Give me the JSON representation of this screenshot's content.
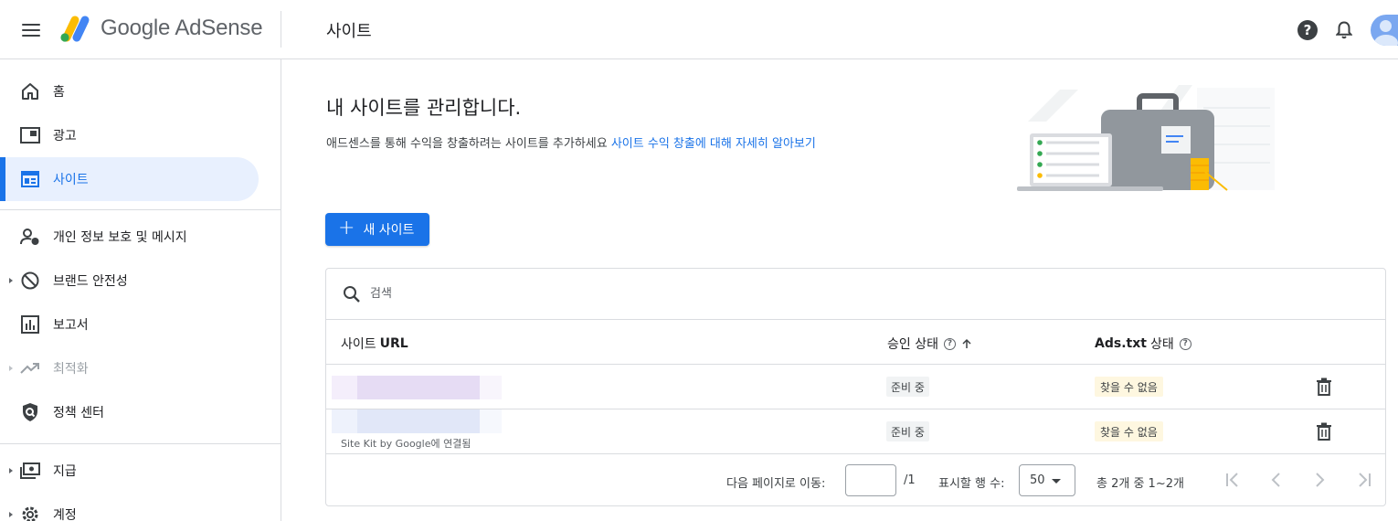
{
  "header": {
    "product_name": "Google AdSense",
    "page_title": "사이트"
  },
  "sidebar": {
    "items": [
      {
        "label": "홈",
        "icon": "home-icon"
      },
      {
        "label": "광고",
        "icon": "ads-icon"
      },
      {
        "label": "사이트",
        "icon": "sites-icon",
        "active": true
      },
      {
        "label": "개인 정보 보호 및 메시지",
        "icon": "privacy-messaging-icon"
      },
      {
        "label": "브랜드 안전성",
        "icon": "block-icon"
      },
      {
        "label": "보고서",
        "icon": "reports-icon"
      },
      {
        "label": "최적화",
        "icon": "trending-up-icon",
        "disabled": true
      },
      {
        "label": "정책 센터",
        "icon": "policy-shield-icon"
      },
      {
        "label": "지급",
        "icon": "payments-icon"
      },
      {
        "label": "계정",
        "icon": "settings-icon"
      }
    ]
  },
  "main": {
    "title": "내 사이트를 관리합니다.",
    "subtitle": "애드센스를 통해 수익을 창출하려는 사이트를 추가하세요",
    "learn_more_link": "사이트 수익 창출에 대해 자세히 알아보기",
    "new_site_button": "새 사이트"
  },
  "table": {
    "search_placeholder": "검색",
    "columns": {
      "site_url_prefix": "사이트",
      "site_url_suffix": "URL",
      "approval_status": "승인 상태",
      "ads_txt_status_prefix": "Ads.txt",
      "ads_txt_status_suffix": "상태"
    },
    "rows": [
      {
        "approval": "준비 중",
        "ads_txt": "찾을 수 없음",
        "note": ""
      },
      {
        "approval": "준비 중",
        "ads_txt": "찾을 수 없음",
        "note": "Site Kit by Google에 연결됨"
      }
    ],
    "footer": {
      "goto_label": "다음 페이지로 이동:",
      "goto_value": "",
      "page_total": "/1",
      "rows_label": "표시할 행 수:",
      "rows_value": "50",
      "range": "총 2개 중 1~2개"
    }
  },
  "colors": {
    "accent": "#1a73e8",
    "active_bg": "#e8f0fe",
    "divider": "#dadce0",
    "warning_chip": "#fef7e0"
  }
}
